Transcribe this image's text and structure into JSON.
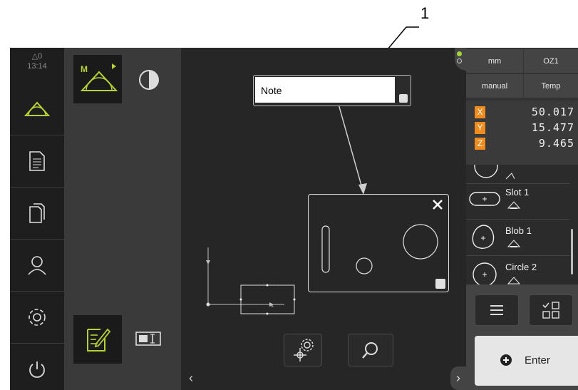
{
  "callout": {
    "number": "1"
  },
  "status": {
    "warnings": "△0",
    "time": "13:14"
  },
  "header": {
    "unit": "mm",
    "coord_system": "OZ1",
    "mode": "manual",
    "temp": "Temp"
  },
  "positions": [
    {
      "axis": "X",
      "value": "50.017"
    },
    {
      "axis": "Y",
      "value": "15.477"
    },
    {
      "axis": "Z",
      "value": "9.465"
    }
  ],
  "features": [
    {
      "label": "Slot 1",
      "icon": "slot-icon"
    },
    {
      "label": "Blob 1",
      "icon": "blob-icon"
    },
    {
      "label": "Circle 2",
      "icon": "circle-icon"
    }
  ],
  "note": {
    "text": "Note"
  },
  "enter": {
    "label": "Enter"
  },
  "icons": [
    "warning-icon",
    "measure-icon",
    "protocol-icon",
    "file-icon",
    "user-icon",
    "settings-icon",
    "power-icon",
    "manual-measure-icon",
    "contrast-icon",
    "annotation-icon",
    "text-field-icon",
    "close-icon",
    "zoom-icon",
    "position-settings-icon",
    "menu-icon",
    "feature-select-icon",
    "plus-icon"
  ],
  "colors": {
    "accent": "#f08c1e",
    "measure_green": "#b5d334",
    "status_green": "#a6d23c"
  }
}
